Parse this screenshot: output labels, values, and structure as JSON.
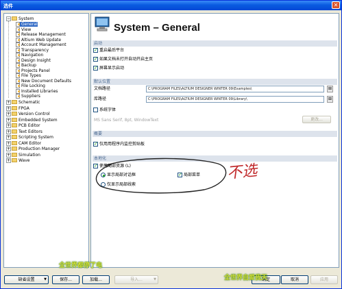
{
  "window": {
    "title": "选件"
  },
  "tree": {
    "system": "System",
    "children": [
      "General",
      "View",
      "Release Management",
      "Altium Web Update",
      "Account Management",
      "Transparency",
      "Navigation",
      "Design Insight",
      "Backup",
      "Projects Panel",
      "File Types",
      "New Document Defaults",
      "File Locking",
      "Installed Libraries",
      "Suppliers"
    ],
    "top": [
      "Schematic",
      "FPGA",
      "Version Control",
      "Embedded System",
      "PCB Editor",
      "Text Editors",
      "Scripting System",
      "CAM Editor",
      "Production Manager",
      "Simulation",
      "Wave"
    ]
  },
  "panel": {
    "title": "System – General",
    "startup": {
      "section": "启动",
      "items": [
        "重启最后平台",
        "如果文档未打开自动开启主页",
        "屏幕显示启动"
      ]
    },
    "defaults": {
      "section": "默认位置",
      "doc_label": "文档路径",
      "doc_path": "C:\\PROGRAM FILES\\ALTIUM DESIGNER WINTER 09\\Examples\\",
      "lib_label": "库路径",
      "lib_path": "C:\\PROGRAM FILES\\ALTIUM DESIGNER WINTER 09\\Library\\"
    },
    "font": {
      "checkbox": "系统字体",
      "sample": "MS Sans Serif, 8pt, WindowText",
      "change": "更改..."
    },
    "general": {
      "section": "概要",
      "clipboard": "仅用用程序内监控剪贴板"
    },
    "localization": {
      "section": "本地化",
      "use_local": "使用局部资源 (L)",
      "dialogs": "显示局部对话框",
      "menus": "局部菜单",
      "hints": "仅显示局部线索"
    },
    "annotation": "不选"
  },
  "footer": {
    "default_settings": "缺省设置",
    "save": "保存...",
    "load": "加载...",
    "import": "导入...",
    "ok": "确定",
    "cancel": "取消",
    "apply": "应用"
  },
  "watermarks": [
    "全世界都停了电",
    "全世界自爱我天"
  ],
  "colors": {
    "selection": "#316AC5",
    "titlebar": "#0A5BE0",
    "section_bg": "#DDE3EC",
    "check": "#21A121"
  }
}
